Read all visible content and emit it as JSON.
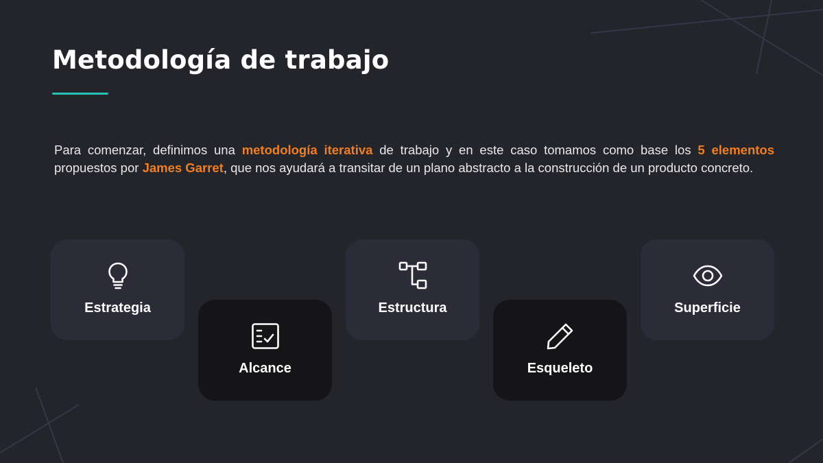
{
  "slide": {
    "title": "Metodología de trabajo",
    "accent_color": "#25c2b6",
    "highlight_color": "#f07f24",
    "intro": {
      "part1": "Para comenzar, definimos una ",
      "highlight1": "metodología iterativa",
      "part2": " de trabajo y en este caso tomamos como base los ",
      "highlight2": "5 elementos",
      "part3": " propuestos por ",
      "highlight3": "James Garret",
      "part4": ", que nos ayudará a transitar de un plano abstracto a la construcción de un producto concreto."
    },
    "cards": [
      {
        "label": "Estrategia",
        "icon": "lightbulb-icon"
      },
      {
        "label": "Alcance",
        "icon": "checklist-icon"
      },
      {
        "label": "Estructura",
        "icon": "sitemap-icon"
      },
      {
        "label": "Esqueleto",
        "icon": "pencil-icon"
      },
      {
        "label": "Superficie",
        "icon": "eye-icon"
      }
    ]
  }
}
